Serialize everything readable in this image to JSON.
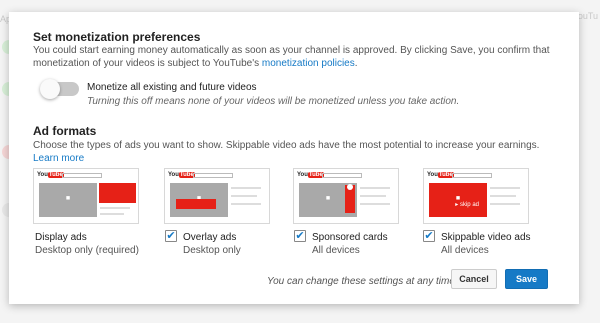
{
  "background": {
    "left_text": "Ap",
    "right_text": "YouTu"
  },
  "monetization": {
    "title": "Set monetization preferences",
    "description_part1": "You could start earning money automatically as soon as your channel is approved. By clicking Save, you confirm that monetization of your videos is subject to YouTube's ",
    "policies_link": "monetization policies",
    "description_end": ".",
    "toggle_label": "Monetize all existing and future videos",
    "toggle_hint": "Turning this off means none of your videos will be monetized unless you take action.",
    "toggle_on": false
  },
  "ad_formats": {
    "title": "Ad formats",
    "description": "Choose the types of ads you want to show. Skippable video ads have the most potential to increase your earnings. ",
    "learn_more": "Learn more",
    "logo_text_you": "You",
    "logo_text_tube": "Tube",
    "skip_text": "▸ skip ad",
    "formats": [
      {
        "name": "Display ads",
        "sub": "Desktop only (required)",
        "checkbox": false
      },
      {
        "name": "Overlay ads",
        "sub": "Desktop only",
        "checkbox": true,
        "checked": true
      },
      {
        "name": "Sponsored cards",
        "sub": "All devices",
        "checkbox": true,
        "checked": true
      },
      {
        "name": "Skippable video ads",
        "sub": "All devices",
        "checkbox": true,
        "checked": true
      }
    ]
  },
  "footer": {
    "note": "You can change these settings at any time.",
    "cancel_label": "Cancel",
    "save_label": "Save"
  },
  "colors": {
    "accent": "#167ac6",
    "ad_red": "#e62117"
  }
}
